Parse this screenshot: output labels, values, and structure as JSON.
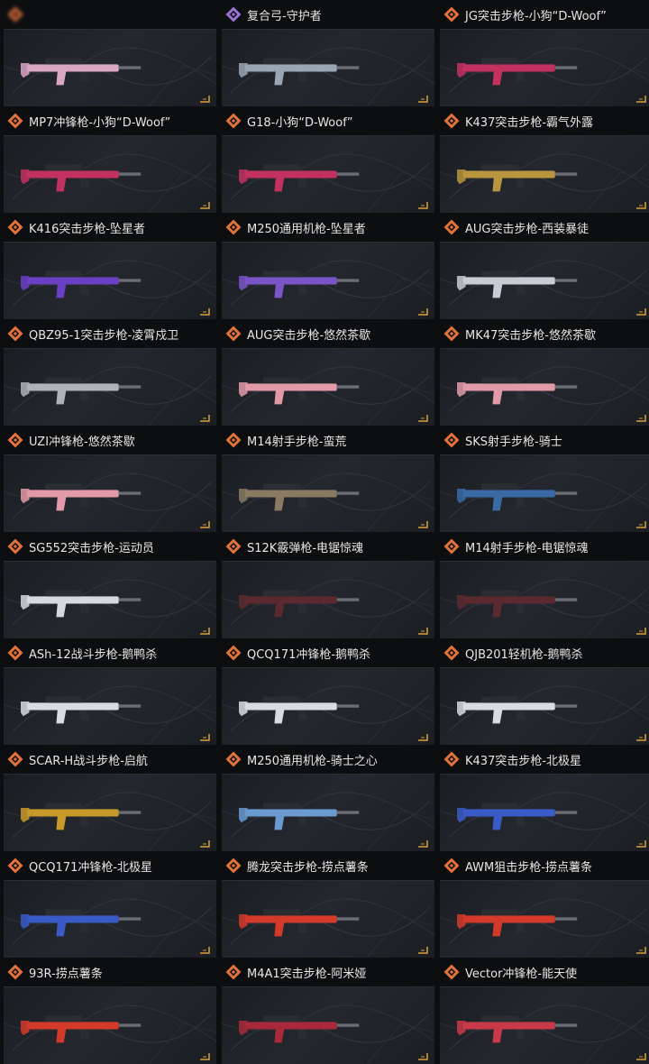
{
  "colors": {
    "rarity_orange": "#e0723a",
    "rarity_purple": "#9a6fd8",
    "accent_yellow": "#d9a23a"
  },
  "cards": [
    {
      "title": "",
      "rarity": "orange",
      "weapon_color": "#d9a6c4",
      "blurred": true
    },
    {
      "title": "复合弓-守护者",
      "rarity": "purple",
      "weapon_color": "#9aa6b4",
      "blurred": false
    },
    {
      "title": "JG突击步枪-小狗“D-Woof”",
      "rarity": "orange",
      "weapon_color": "#c2315f",
      "blurred": false
    },
    {
      "title": "MP7冲锋枪-小狗“D-Woof”",
      "rarity": "orange",
      "weapon_color": "#c2315f",
      "blurred": false
    },
    {
      "title": "G18-小狗“D-Woof”",
      "rarity": "orange",
      "weapon_color": "#c2315f",
      "blurred": false
    },
    {
      "title": "K437突击步枪-霸气外露",
      "rarity": "orange",
      "weapon_color": "#b8953e",
      "blurred": false
    },
    {
      "title": "K416突击步枪-坠星者",
      "rarity": "orange",
      "weapon_color": "#6b3fc4",
      "blurred": false
    },
    {
      "title": "M250通用机枪-坠星者",
      "rarity": "orange",
      "weapon_color": "#7a55c8",
      "blurred": false
    },
    {
      "title": "AUG突击步枪-西装暴徒",
      "rarity": "orange",
      "weapon_color": "#c8ccd4",
      "blurred": false
    },
    {
      "title": "QBZ95-1突击步枪-凌霄戍卫",
      "rarity": "orange",
      "weapon_color": "#aeb3ba",
      "blurred": false
    },
    {
      "title": "AUG突击步枪-悠然茶歇",
      "rarity": "orange",
      "weapon_color": "#e39aa8",
      "blurred": false
    },
    {
      "title": "MK47突击步枪-悠然茶歇",
      "rarity": "orange",
      "weapon_color": "#e39aa8",
      "blurred": false
    },
    {
      "title": "UZI冲锋枪-悠然茶歇",
      "rarity": "orange",
      "weapon_color": "#e39aa8",
      "blurred": false
    },
    {
      "title": "M14射手步枪-蛮荒",
      "rarity": "orange",
      "weapon_color": "#8a7a62",
      "blurred": false
    },
    {
      "title": "SKS射手步枪-骑士",
      "rarity": "orange",
      "weapon_color": "#3a6aa6",
      "blurred": false
    },
    {
      "title": "SG552突击步枪-运动员",
      "rarity": "orange",
      "weapon_color": "#d6d9de",
      "blurred": false
    },
    {
      "title": "S12K霰弹枪-电锯惊魂",
      "rarity": "orange",
      "weapon_color": "#5a2a30",
      "blurred": false
    },
    {
      "title": "M14射手步枪-电锯惊魂",
      "rarity": "orange",
      "weapon_color": "#5a2a30",
      "blurred": false
    },
    {
      "title": "ASh-12战斗步枪-鹅鸭杀",
      "rarity": "orange",
      "weapon_color": "#d9dbe0",
      "blurred": false
    },
    {
      "title": "QCQ171冲锋枪-鹅鸭杀",
      "rarity": "orange",
      "weapon_color": "#d9dbe0",
      "blurred": false
    },
    {
      "title": "QJB201轻机枪-鹅鸭杀",
      "rarity": "orange",
      "weapon_color": "#d9dbe0",
      "blurred": false
    },
    {
      "title": "SCAR-H战斗步枪-启航",
      "rarity": "orange",
      "weapon_color": "#c89a2a",
      "blurred": false
    },
    {
      "title": "M250通用机枪-骑士之心",
      "rarity": "orange",
      "weapon_color": "#6a9ad0",
      "blurred": false
    },
    {
      "title": "K437突击步枪-北极星",
      "rarity": "orange",
      "weapon_color": "#3a5ac8",
      "blurred": false
    },
    {
      "title": "QCQ171冲锋枪-北极星",
      "rarity": "orange",
      "weapon_color": "#3a5ac8",
      "blurred": false
    },
    {
      "title": "腾龙突击步枪-捞点薯条",
      "rarity": "orange",
      "weapon_color": "#d43a2a",
      "blurred": false
    },
    {
      "title": "AWM狙击步枪-捞点薯条",
      "rarity": "orange",
      "weapon_color": "#d43a2a",
      "blurred": false
    },
    {
      "title": "93R-捞点薯条",
      "rarity": "orange",
      "weapon_color": "#d43a2a",
      "blurred": false
    },
    {
      "title": "M4A1突击步枪-阿米娅",
      "rarity": "orange",
      "weapon_color": "#a82a3a",
      "blurred": false
    },
    {
      "title": "Vector冲锋枪-能天使",
      "rarity": "orange",
      "weapon_color": "#c83a4a",
      "blurred": false
    }
  ]
}
